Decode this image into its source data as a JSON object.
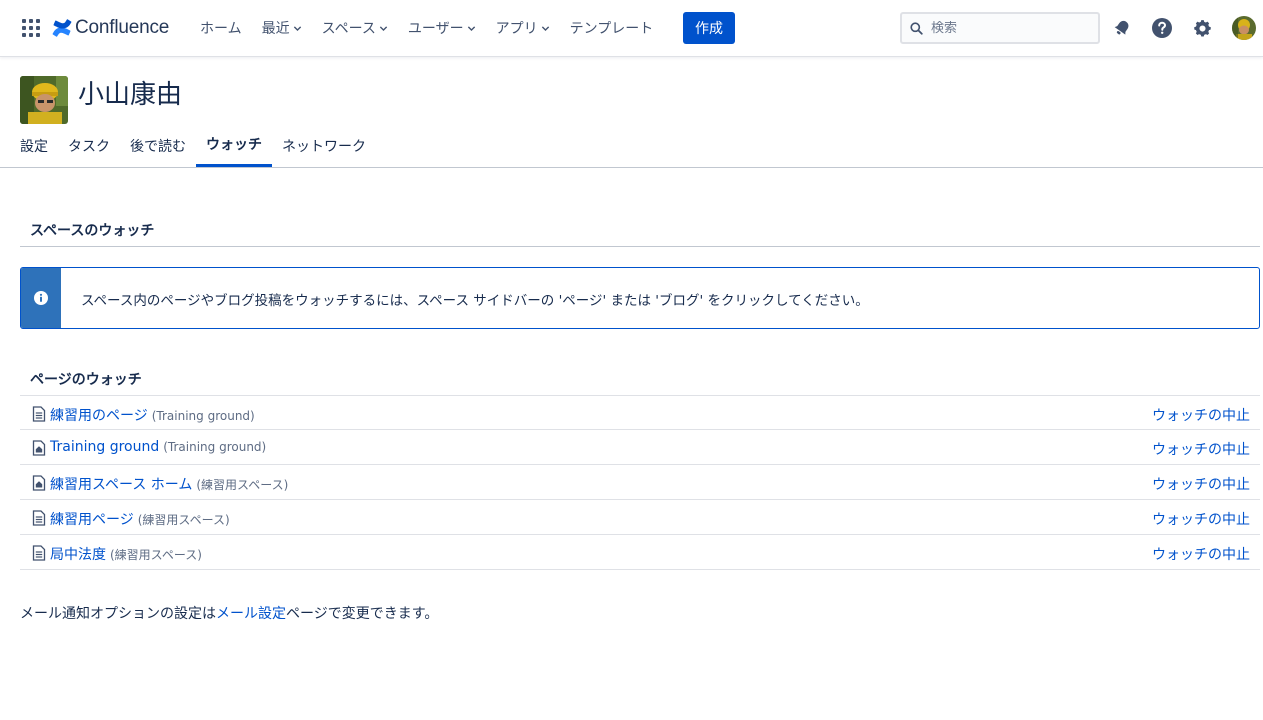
{
  "app": {
    "name": "Confluence"
  },
  "nav": {
    "items": [
      {
        "label": "ホーム",
        "dropdown": false
      },
      {
        "label": "最近",
        "dropdown": true
      },
      {
        "label": "スペース",
        "dropdown": true
      },
      {
        "label": "ユーザー",
        "dropdown": true
      },
      {
        "label": "アプリ",
        "dropdown": true
      },
      {
        "label": "テンプレート",
        "dropdown": false
      }
    ],
    "create_label": "作成",
    "search_placeholder": "検索"
  },
  "colors": {
    "primary": "#0052cc",
    "info_bar": "#2e72ba",
    "text": "#172b4d",
    "muted": "#5e6c84"
  },
  "profile": {
    "name": "小山康由"
  },
  "tabs": [
    {
      "label": "設定",
      "active": false
    },
    {
      "label": "タスク",
      "active": false
    },
    {
      "label": "後で読む",
      "active": false
    },
    {
      "label": "ウォッチ",
      "active": true
    },
    {
      "label": "ネットワーク",
      "active": false
    }
  ],
  "spaces_watch": {
    "heading": "スペースのウォッチ",
    "info_message": "スペース内のページやブログ投稿をウォッチするには、スペース サイドバーの 'ページ' または 'ブログ' をクリックしてください。"
  },
  "pages_watch": {
    "heading": "ページのウォッチ",
    "stop_label": "ウォッチの中止",
    "rows": [
      {
        "title": "練習用のページ",
        "space": "(Training ground)",
        "icon": "page-icon"
      },
      {
        "title": "Training ground",
        "space": "(Training ground)",
        "icon": "home-page-icon"
      },
      {
        "title": "練習用スペース ホーム",
        "space": "(練習用スペース)",
        "icon": "home-page-icon"
      },
      {
        "title": "練習用ページ",
        "space": "(練習用スペース)",
        "icon": "page-icon"
      },
      {
        "title": "局中法度",
        "space": "(練習用スペース)",
        "icon": "page-icon"
      }
    ]
  },
  "footer": {
    "prefix": "メール通知オプションの設定は",
    "link": "メール設定",
    "suffix": "ページで変更できます。"
  }
}
